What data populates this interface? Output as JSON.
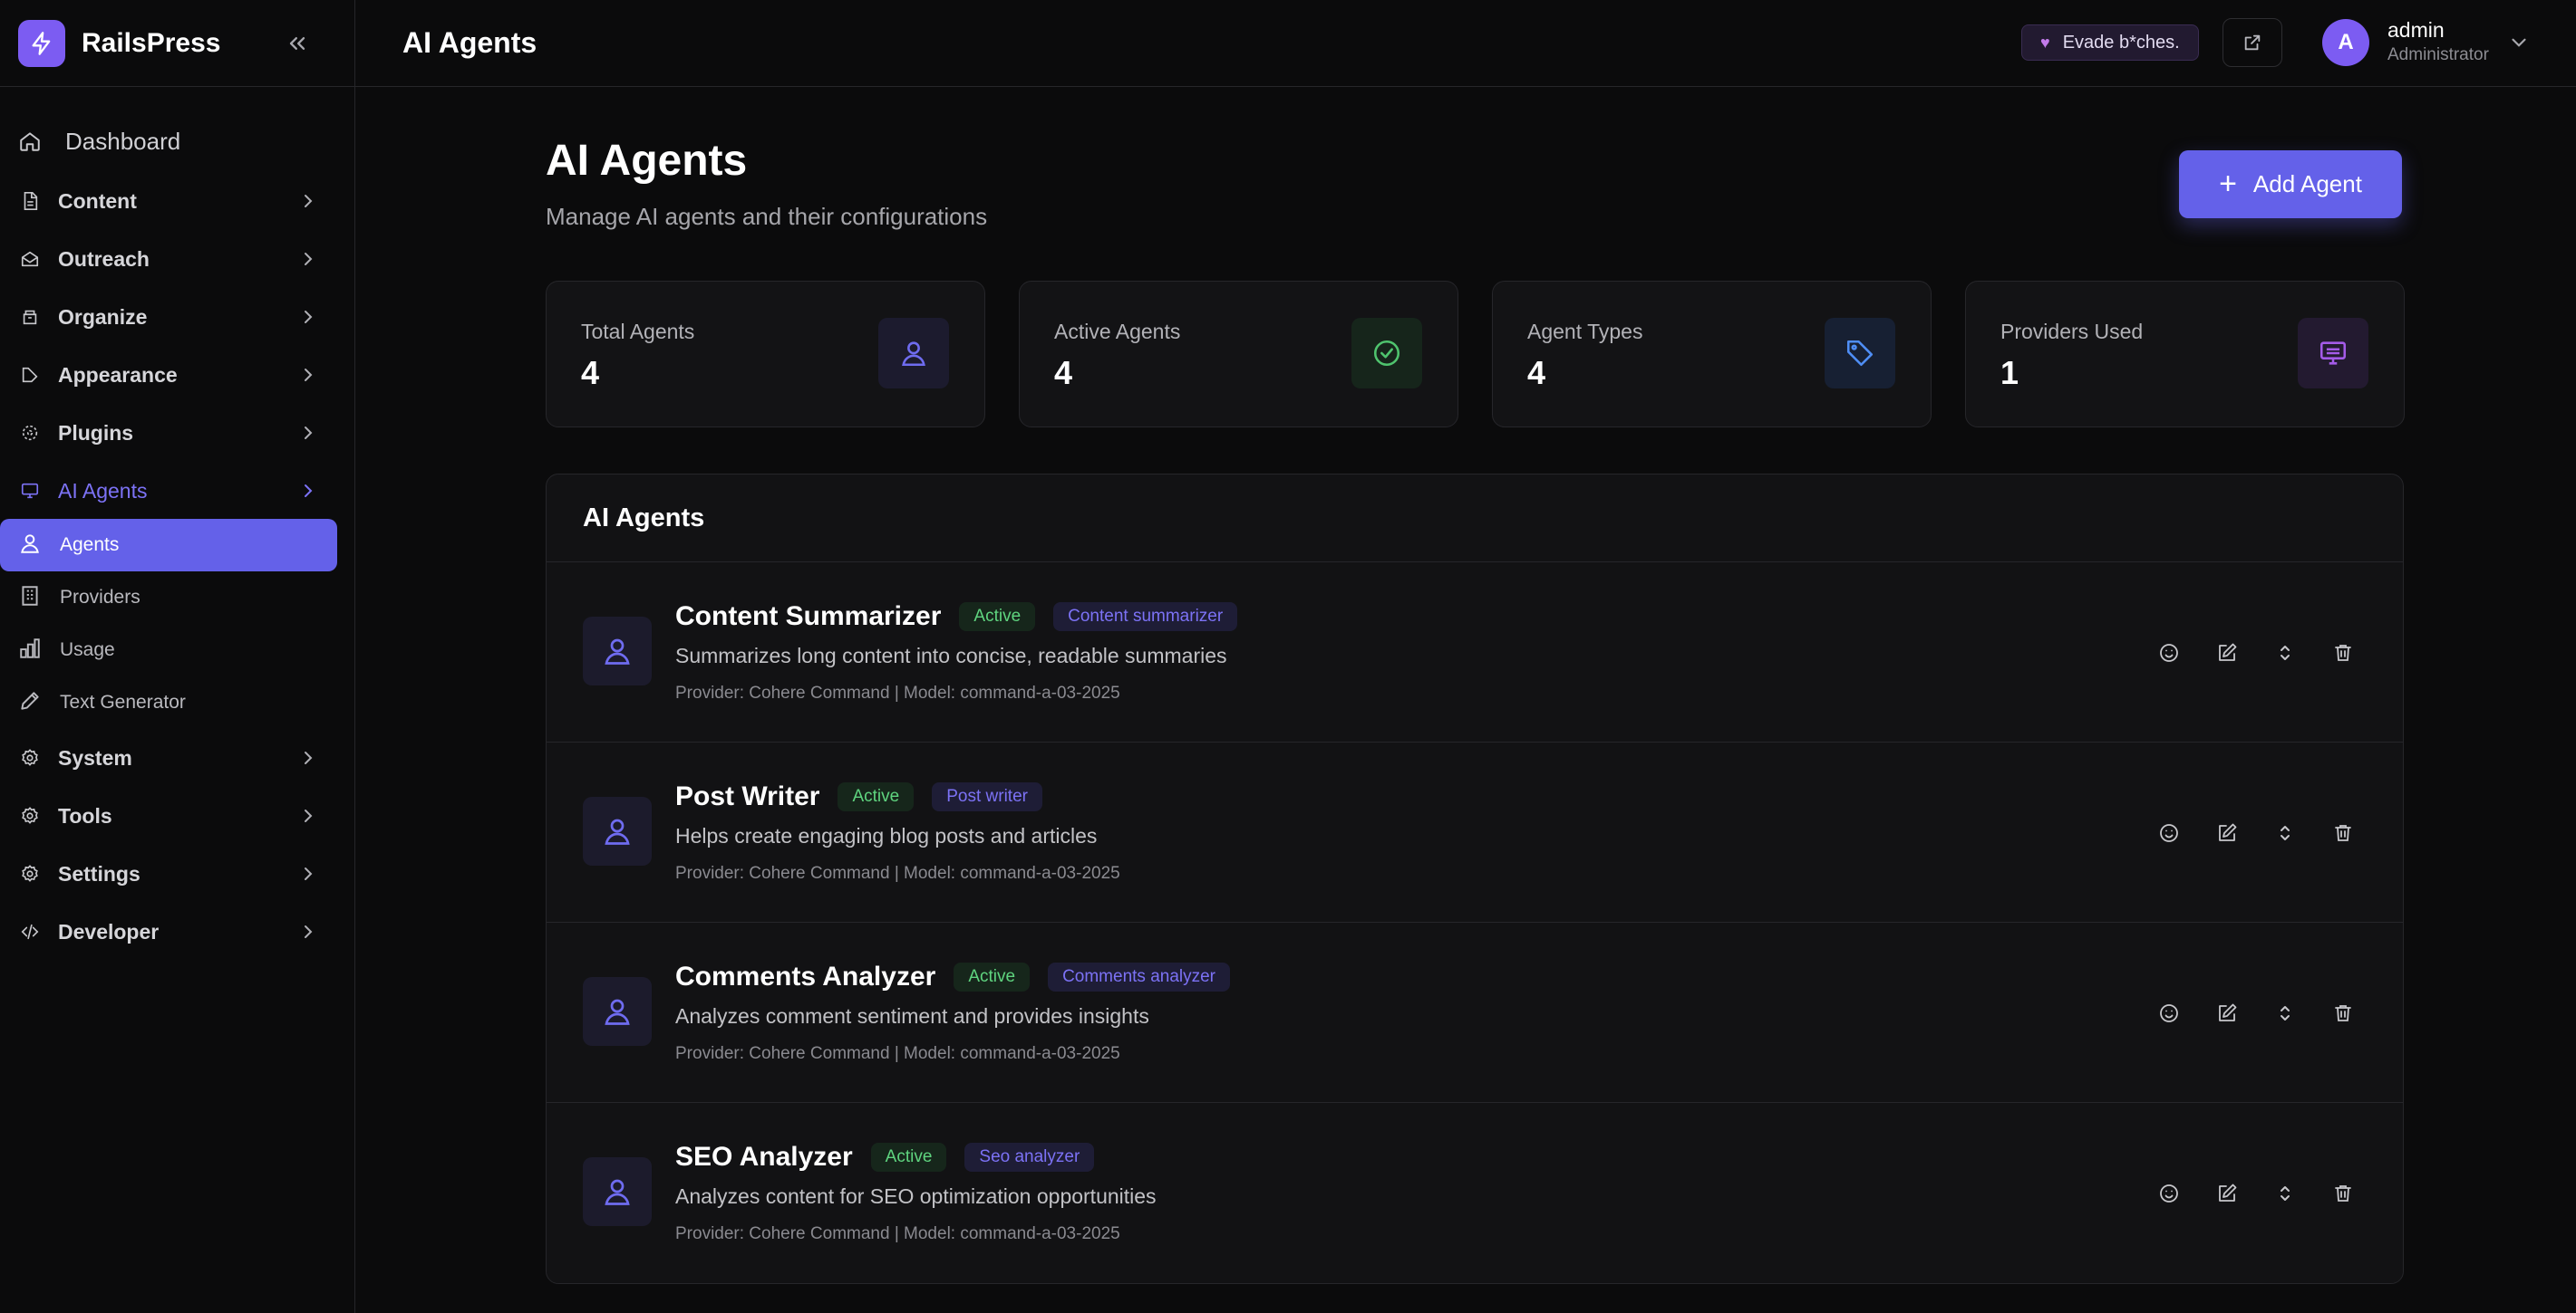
{
  "app": {
    "name": "RailsPress"
  },
  "sidebar": {
    "items": [
      {
        "label": "Dashboard",
        "icon": "home-icon"
      },
      {
        "label": "Content",
        "icon": "document-icon"
      },
      {
        "label": "Outreach",
        "icon": "mail-open-icon"
      },
      {
        "label": "Organize",
        "icon": "archive-icon"
      },
      {
        "label": "Appearance",
        "icon": "palette-icon"
      },
      {
        "label": "Plugins",
        "icon": "puzzle-icon"
      },
      {
        "label": "AI Agents",
        "icon": "monitor-icon"
      },
      {
        "label": "System",
        "icon": "gear-icon"
      },
      {
        "label": "Tools",
        "icon": "gear-icon"
      },
      {
        "label": "Settings",
        "icon": "gear-icon"
      },
      {
        "label": "Developer",
        "icon": "code-icon"
      }
    ],
    "subitems": [
      {
        "label": "Agents",
        "icon": "user-icon",
        "active": true
      },
      {
        "label": "Providers",
        "icon": "building-icon",
        "active": false
      },
      {
        "label": "Usage",
        "icon": "bar-chart-icon",
        "active": false
      },
      {
        "label": "Text Generator",
        "icon": "pencil-icon",
        "active": false
      }
    ]
  },
  "topbar": {
    "title": "AI Agents",
    "pill": "Evade b*ches.",
    "user": {
      "initial": "A",
      "name": "admin",
      "role": "Administrator"
    }
  },
  "page": {
    "title": "AI Agents",
    "subtitle": "Manage AI agents and their configurations",
    "add_button": "Add Agent"
  },
  "stats": [
    {
      "label": "Total Agents",
      "value": "4",
      "icon": "user-icon",
      "color": "#6f6cf0",
      "bg": "#1c1b2e"
    },
    {
      "label": "Active Agents",
      "value": "4",
      "icon": "check-circle-icon",
      "color": "#4fc46e",
      "bg": "#16251b"
    },
    {
      "label": "Agent Types",
      "value": "4",
      "icon": "tag-icon",
      "color": "#4f8ef5",
      "bg": "#172033"
    },
    {
      "label": "Providers Used",
      "value": "1",
      "icon": "monitor-icon",
      "color": "#a45be8",
      "bg": "#231a30"
    }
  ],
  "agents_card": {
    "title": "AI Agents",
    "agents": [
      {
        "name": "Content Summarizer",
        "status": "Active",
        "type": "Content summarizer",
        "description": "Summarizes long content into concise, readable summaries",
        "meta": "Provider: Cohere Command | Model: command-a-03-2025"
      },
      {
        "name": "Post Writer",
        "status": "Active",
        "type": "Post writer",
        "description": "Helps create engaging blog posts and articles",
        "meta": "Provider: Cohere Command | Model: command-a-03-2025"
      },
      {
        "name": "Comments Analyzer",
        "status": "Active",
        "type": "Comments analyzer",
        "description": "Analyzes comment sentiment and provides insights",
        "meta": "Provider: Cohere Command | Model: command-a-03-2025"
      },
      {
        "name": "SEO Analyzer",
        "status": "Active",
        "type": "Seo analyzer",
        "description": "Analyzes content for SEO optimization opportunities",
        "meta": "Provider: Cohere Command | Model: command-a-03-2025"
      }
    ]
  },
  "colors": {
    "accent": "#6461e9",
    "brand": "#7c5cf2",
    "active_badge": "#5fd47f"
  }
}
